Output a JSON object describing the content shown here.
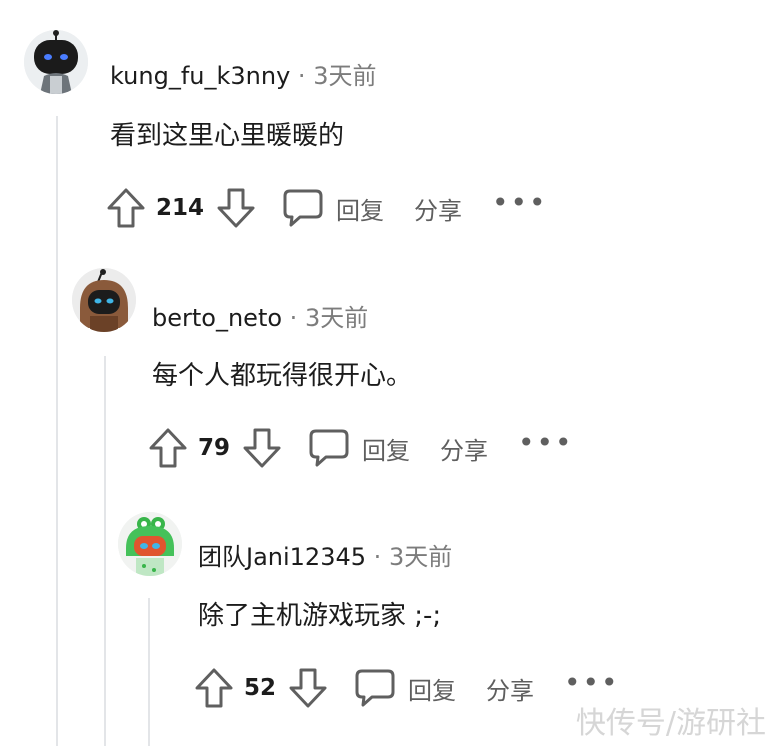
{
  "comments": [
    {
      "username": "kung_fu_k3nny",
      "separator": "·",
      "time": "3天前",
      "text": "看到这里心里暖暖的",
      "score": "214",
      "reply_label": "回复",
      "share_label": "分享",
      "more_label": "•••",
      "avatar_icon": "robot-avatar-icon"
    },
    {
      "username": "berto_neto",
      "separator": "·",
      "time": "3天前",
      "text": "每个人都玩得很开心。",
      "score": "79",
      "reply_label": "回复",
      "share_label": "分享",
      "more_label": "•••",
      "avatar_icon": "robot-hood-avatar-icon"
    },
    {
      "username": "团队Jani12345",
      "separator": "·",
      "time": "3天前",
      "text": "除了主机游戏玩家 ;-;",
      "score": "52",
      "reply_label": "回复",
      "share_label": "分享",
      "more_label": "•••",
      "avatar_icon": "frog-hat-avatar-icon"
    }
  ],
  "watermark": "快传号/游研社",
  "colors": {
    "text": "#1c1c1c",
    "muted": "#7c7c7c",
    "thread_line": "#e3e5e8",
    "icon": "#5f5f5f"
  }
}
